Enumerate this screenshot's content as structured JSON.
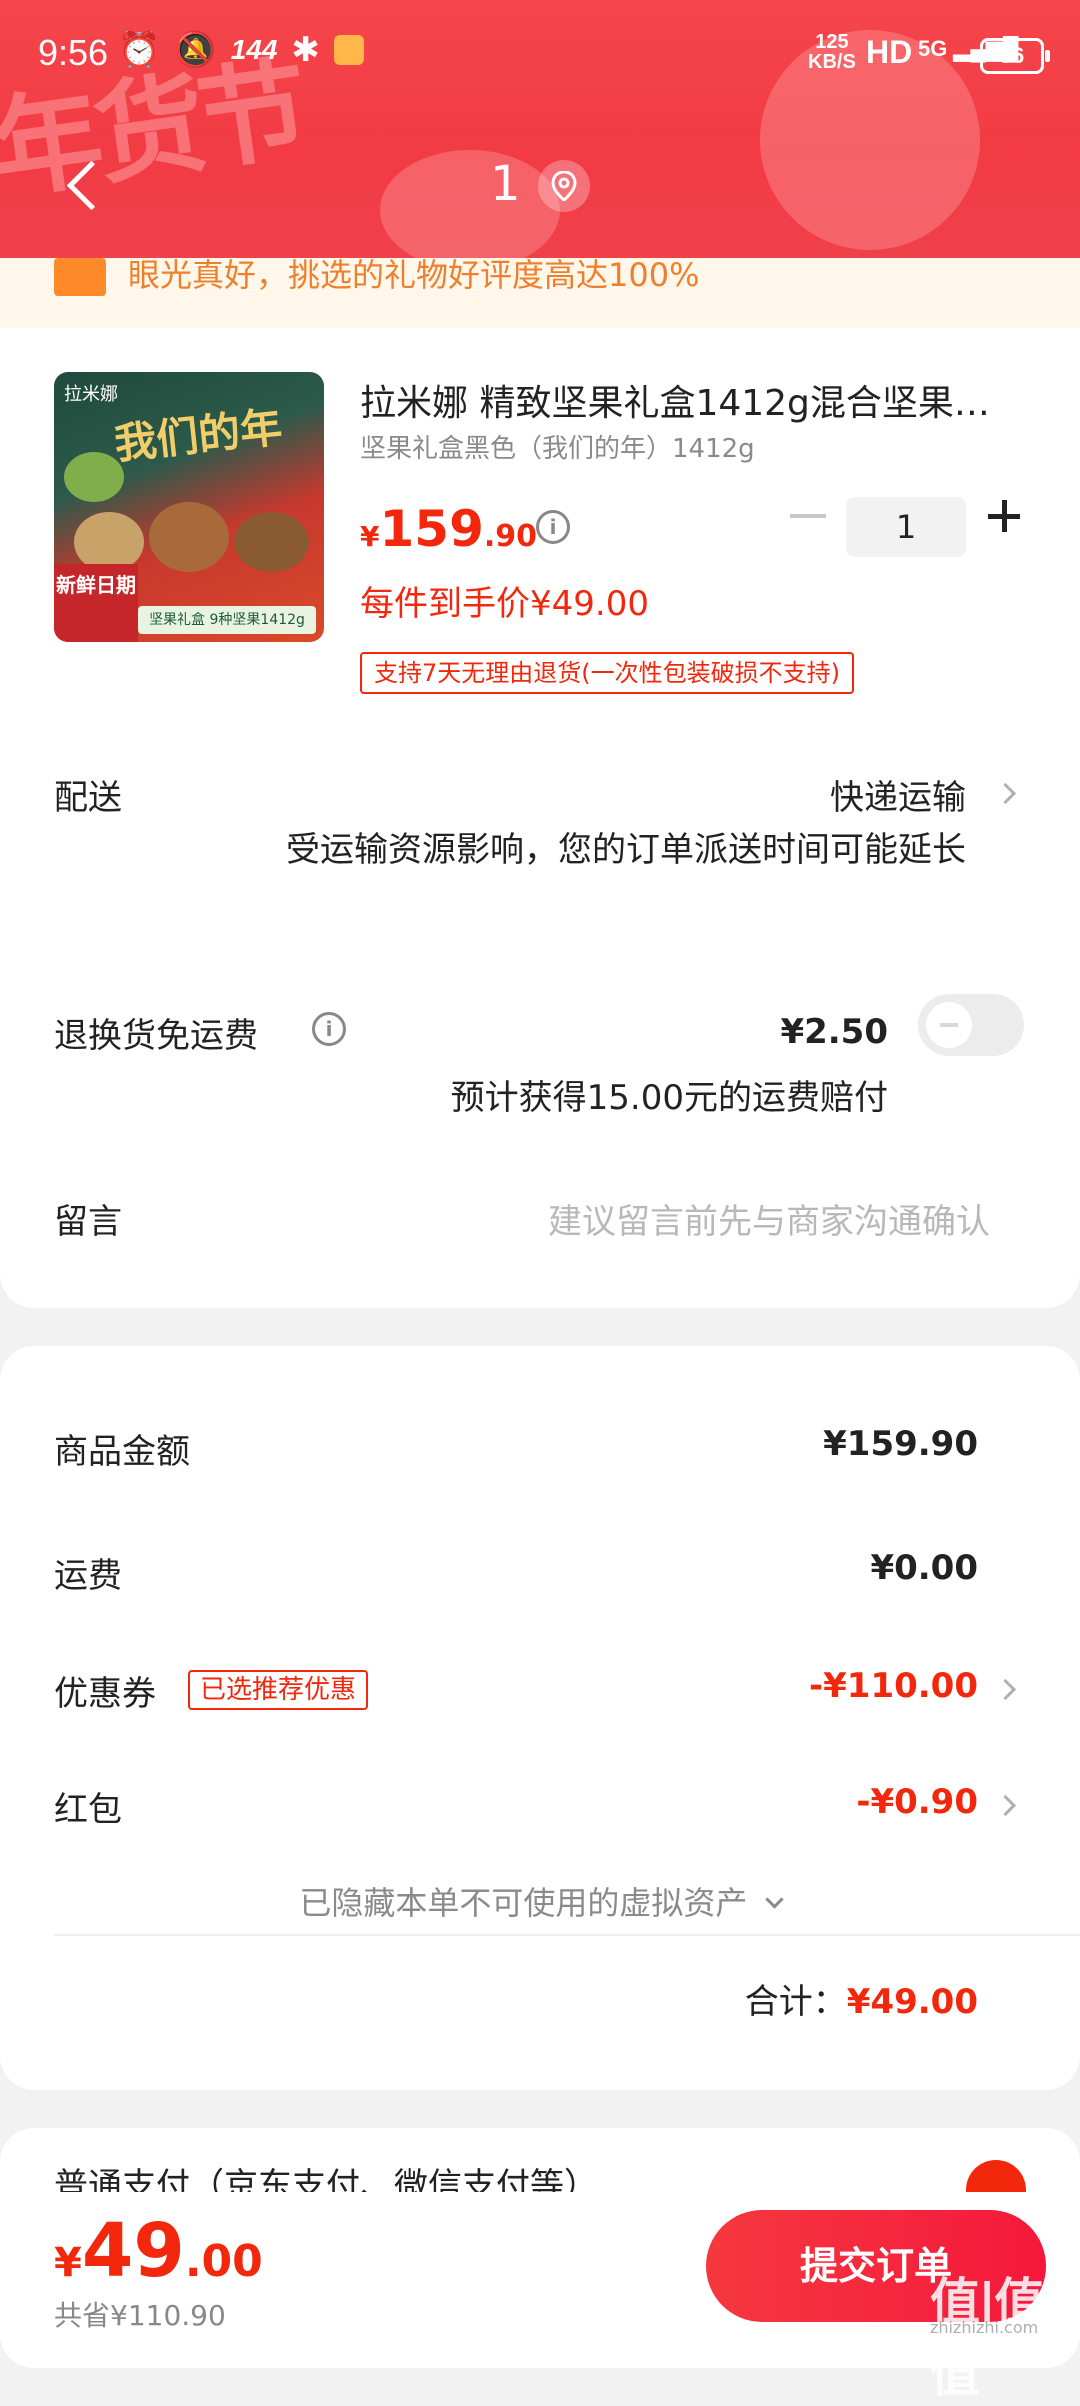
{
  "status_bar": {
    "time": "9:56",
    "refresh_rate": "144",
    "net_speed_value": "125",
    "net_speed_unit": "KB/S",
    "hd": "HD",
    "signal": "5G",
    "battery": "36"
  },
  "nav": {
    "address_label": "1"
  },
  "notice": {
    "text": "眼光真好，挑选的礼物好评度高达100%"
  },
  "product": {
    "title": "拉米娜 精致坚果礼盒1412g混合坚果…",
    "spec": "坚果礼盒黑色（我们的年）1412g",
    "price_currency": "¥",
    "price_int": "159",
    "price_dec": ".90",
    "quantity": "1",
    "unit_price": "每件到手价¥49.00",
    "return_policy": "支持7天无理由退货(一次性包装破损不支持)",
    "thumb_brand": "拉米娜",
    "thumb_title": "我们的年",
    "thumb_tag": "新鲜日期",
    "thumb_band": "坚果礼盒 9种坚果1412g"
  },
  "delivery": {
    "label": "配送",
    "value": "快递运输",
    "note": "受运输资源影响，您的订单派送时间可能延长"
  },
  "return_insurance": {
    "label": "退换货免运费",
    "price": "¥2.50",
    "note": "预计获得15.00元的运费赔付",
    "enabled": false
  },
  "message": {
    "label": "留言",
    "placeholder": "建议留言前先与商家沟通确认"
  },
  "summary": {
    "goods_label": "商品金额",
    "goods_value": "¥159.90",
    "shipping_label": "运费",
    "shipping_value": "¥0.00",
    "coupon_label": "优惠券",
    "coupon_tag": "已选推荐优惠",
    "coupon_value": "-¥110.00",
    "redpack_label": "红包",
    "redpack_value": "-¥0.90",
    "hidden_assets": "已隐藏本单不可使用的虚拟资产",
    "total_label": "合计：",
    "total_value": "¥49.00"
  },
  "payment": {
    "method": "普通支付（京东支付、微信支付等）"
  },
  "bottom": {
    "currency": "¥",
    "total_int": "49",
    "total_dec": ".00",
    "saved": "共省¥110.90",
    "submit": "提交订单"
  },
  "watermark": {
    "logo": "值|值|值",
    "domain": "zhizhizhi.com"
  },
  "colors": {
    "accent_red": "#f2270c",
    "header_red": "#f23b44"
  }
}
